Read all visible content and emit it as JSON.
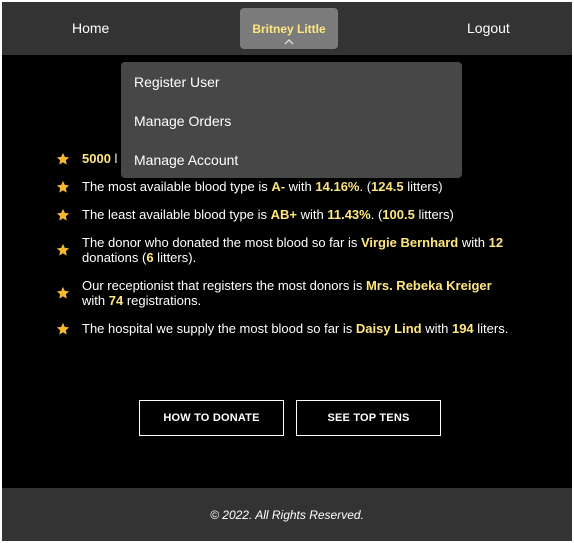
{
  "nav": {
    "home": "Home",
    "user_name": "Britney Little",
    "logout": "Logout"
  },
  "dropdown": {
    "items": [
      "Register User",
      "Manage Orders",
      "Manage Account"
    ]
  },
  "facts": [
    {
      "pre": "",
      "v1": "5000",
      "mid1": " l",
      "v2": "",
      "mid2": "",
      "v3": "",
      "post": ""
    },
    {
      "pre": "The most available blood type is ",
      "v1": "A-",
      "mid1": " with ",
      "v2": "14.16%",
      "mid2": ". (",
      "v3": "124.5",
      "post": " litters)"
    },
    {
      "pre": "The least available blood type is ",
      "v1": "AB+",
      "mid1": " with ",
      "v2": "11.43%",
      "mid2": ". (",
      "v3": "100.5",
      "post": " litters)"
    },
    {
      "pre": "The donor who donated the most blood so far is ",
      "v1": "Virgie Bernhard",
      "mid1": " with ",
      "v2": "12",
      "mid2": " donations (",
      "v3": "6",
      "post": " litters)."
    },
    {
      "pre": "Our receptionist that registers the most donors is ",
      "v1": "Mrs. Rebeka Kreiger",
      "mid1": " with ",
      "v2": "74",
      "mid2": " registrations.",
      "v3": "",
      "post": ""
    },
    {
      "pre": "The hospital we supply the most blood so far is ",
      "v1": "Daisy Lind",
      "mid1": " with ",
      "v2": "194",
      "mid2": " liters.",
      "v3": "",
      "post": ""
    }
  ],
  "buttons": {
    "donate": "HOW TO DONATE",
    "top_tens": "SEE TOP TENS"
  },
  "footer": {
    "text": "© 2022. All Rights Reserved."
  },
  "colors": {
    "highlight": "#ffe680",
    "star": "#f5b82e",
    "nav_bg": "#333333"
  }
}
